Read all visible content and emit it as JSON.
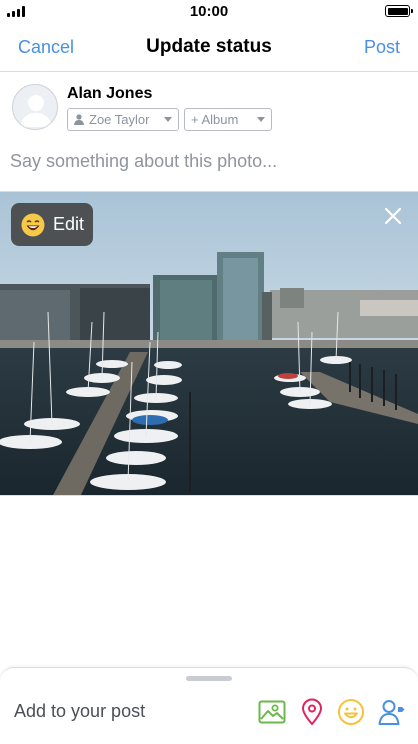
{
  "status_bar": {
    "time": "10:00"
  },
  "nav": {
    "cancel_label": "Cancel",
    "title": "Update status",
    "post_label": "Post"
  },
  "user": {
    "name": "Alan Jones"
  },
  "audience": {
    "label": "Zoe Taylor",
    "icon": "person-icon"
  },
  "album": {
    "label": "+ Album"
  },
  "composer": {
    "placeholder": "Say something about this photo..."
  },
  "photo": {
    "edit_label": "Edit",
    "subject": "harbour marina with sailboats and office buildings"
  },
  "bottom_bar": {
    "add_label": "Add to your post",
    "tools": [
      "photo-icon",
      "location-pin-icon",
      "feeling-smiley-icon",
      "tag-people-icon"
    ]
  },
  "colors": {
    "accent": "#4a90e2",
    "photo_tool": "#6bb84a",
    "location_tool": "#e0245e",
    "feeling_tool": "#f5c33b",
    "tag_tool": "#4a90e2"
  }
}
